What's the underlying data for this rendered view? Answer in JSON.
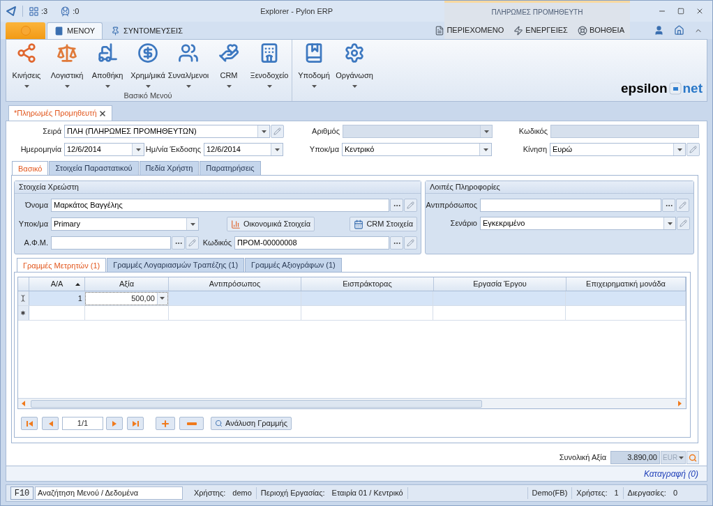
{
  "titlebar": {
    "title": "Explorer - Pylon ERP",
    "open_windows": ":3",
    "jobs": ":0",
    "context_tab": "ΠΛΗΡΩΜΕΣ ΠΡΟΜΗΘΕΥΤΗ"
  },
  "ribbon_tabs": [
    {
      "label": "ΜΕΝΟΥ",
      "selected": true
    },
    {
      "label": "ΣΥΝΤΟΜΕΥΣΕΙΣ",
      "selected": false
    }
  ],
  "context_commands": [
    "ΠΕΡΙΕΧΟΜΕΝΟ",
    "ΕΝΕΡΓΕΙΕΣ",
    "ΒΟΗΘΕΙΑ"
  ],
  "ribbon_groups": [
    {
      "label": "Βασικό Μενού",
      "items": [
        "Κινήσεις",
        "Λογιστική",
        "Αποθήκη",
        "Χρημ/μικά",
        "Συναλ/μενοι",
        "CRM",
        "Ξενοδοχείο"
      ]
    },
    {
      "items": [
        "Υποδομή",
        "Οργάνωση"
      ]
    }
  ],
  "logo": {
    "left": "epsilon",
    "right": "net"
  },
  "document_tab": {
    "title": "*Πληρωμές Προμηθευτή"
  },
  "header_rows": [
    [
      {
        "label": "Σειρά",
        "value": "ΠΛΗ (ΠΛΗΡΩΜΕΣ ΠΡΟΜΗΘΕΥΤΩΝ)",
        "kind": "combo",
        "edit_button": true,
        "disabled": false
      },
      {
        "label": "Αριθμός",
        "kind": "combo",
        "edit_button": false,
        "disabled": true
      },
      {
        "label": "Κωδικός",
        "kind": "text",
        "edit_button": false,
        "disabled": true
      }
    ],
    [
      {
        "label": "Ημερομηνία",
        "value": "12/6/2014",
        "kind": "combo",
        "edit_button": false,
        "disabled": false
      },
      {
        "label": "Ημ/νία Έκδοσης",
        "value": "12/6/2014",
        "kind": "combo",
        "edit_button": false,
        "disabled": false
      },
      {
        "label": "Υποκ/μα",
        "value": "Κεντρικό",
        "kind": "combo",
        "edit_button": false,
        "disabled": false
      },
      {
        "label": "Κίνηση",
        "value": "Ευρώ",
        "kind": "combo",
        "edit_button": true,
        "disabled": false
      }
    ]
  ],
  "tabs": [
    {
      "label": "Βασικό",
      "selected": true
    },
    {
      "label": "Στοιχεία Παραστατικού",
      "selected": false
    },
    {
      "label": "Πεδία Χρήστη",
      "selected": false
    },
    {
      "label": "Παρατηρήσεις",
      "selected": false
    }
  ],
  "debtor": {
    "title": "Στοιχεία Χρεώστη",
    "name": {
      "label": "Όνομα",
      "value": "Μαρκάτος Βαγγέλης",
      "kind": "lookup",
      "edit_button": true,
      "disabled": false
    },
    "subaccount": {
      "label": "Υποκ/μα",
      "value": "Primary",
      "kind": "combo",
      "edit_button": false,
      "disabled": false
    },
    "financial_button": "Οικονομικά Στοιχεία",
    "crm_button": "CRM Στοιχεία",
    "tax_id": {
      "label": "Α.Φ.Μ.",
      "kind": "lookup",
      "edit_button": true,
      "disabled": false
    },
    "code": {
      "label": "Κωδικός",
      "value": "ΠΡΟΜ-00000008",
      "kind": "lookup",
      "edit_button": true,
      "disabled": false
    }
  },
  "other_info": {
    "title": "Λοιπές Πληροφορίες",
    "fields": [
      {
        "label": "Αντιπρόσωπος",
        "kind": "lookup",
        "edit_button": true,
        "disabled": false
      },
      {
        "label": "Σενάριο",
        "value": "Εγκεκριμένο",
        "kind": "combo",
        "edit_button": true,
        "disabled": false
      }
    ]
  },
  "line_tabs": [
    {
      "label": "Γραμμές Μετρητών (1)",
      "selected": true
    },
    {
      "label": "Γραμμές Λογαριασμών Τραπέζης (1)",
      "selected": false
    },
    {
      "label": "Γραμμές Αξιογράφων (1)",
      "selected": false
    }
  ],
  "grid": {
    "columns": [
      {
        "label": "Α/Α",
        "sorted": true
      },
      {
        "label": "Αξία",
        "sorted": false
      },
      {
        "label": "Αντιπρόσωπος",
        "sorted": false
      },
      {
        "label": "Εισπράκτορας",
        "sorted": false
      },
      {
        "label": "Εργασία Έργου",
        "sorted": false
      },
      {
        "label": "Επιχειρηματική μονάδα",
        "sorted": false
      }
    ],
    "rows": [
      {
        "number": "1",
        "value": "500,00",
        "selected": true
      }
    ],
    "new_row": true
  },
  "navigator": {
    "position": "1/1",
    "analysis_button": "Ανάλυση Γραμμής"
  },
  "total": {
    "label": "Συνολική Αξία",
    "value": "3.890,00",
    "currency": "EUR"
  },
  "log_link": "Καταγραφή (0)",
  "status_bar": {
    "key": "F10",
    "search_value": "Αναζήτηση Μενού / Δεδομένα",
    "left_items": [
      {
        "label": "Χρήστης:",
        "value": "demo"
      },
      {
        "label": "Περιοχή Εργασίας:",
        "value": "Εταιρία 01 / Κεντρικό"
      }
    ],
    "right_items": [
      {
        "label": "Demo(FB)"
      },
      {
        "label": "Χρήστες:",
        "value": "1"
      },
      {
        "label": "Διεργασίες:",
        "value": "0"
      }
    ]
  }
}
